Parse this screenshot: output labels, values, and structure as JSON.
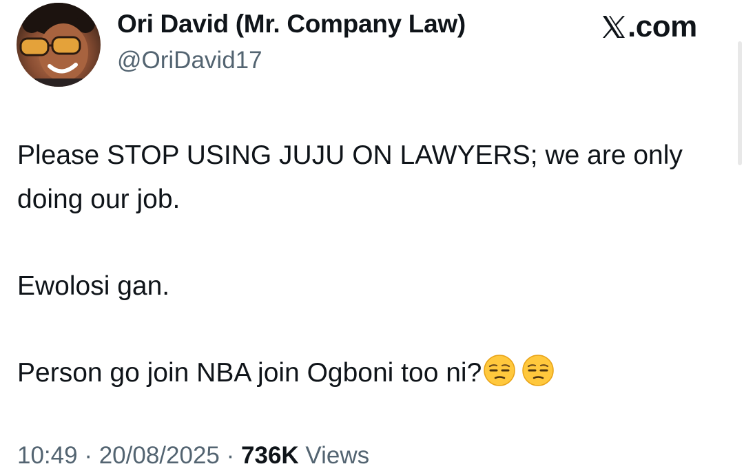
{
  "author": {
    "display_name": "Ori David (Mr. Company Law)",
    "handle": "@OriDavid17",
    "avatar_icon": "profile-photo"
  },
  "brand": {
    "label": ".com",
    "icon": "x-logo-icon"
  },
  "tweet": {
    "paragraphs": [
      "Please STOP USING JUJU ON LAWYERS; we are only doing our job.",
      "Ewolosi gan.",
      "Person go join NBA join Ogboni too ni?"
    ],
    "emojis": [
      "unamused-face-emoji",
      "unamused-face-emoji"
    ]
  },
  "meta": {
    "time": "10:49",
    "separator": "·",
    "date": "20/08/2025",
    "views_count": "736K",
    "views_label": "Views"
  },
  "colors": {
    "text": "#0f1419",
    "muted": "#536471",
    "background": "#ffffff"
  }
}
